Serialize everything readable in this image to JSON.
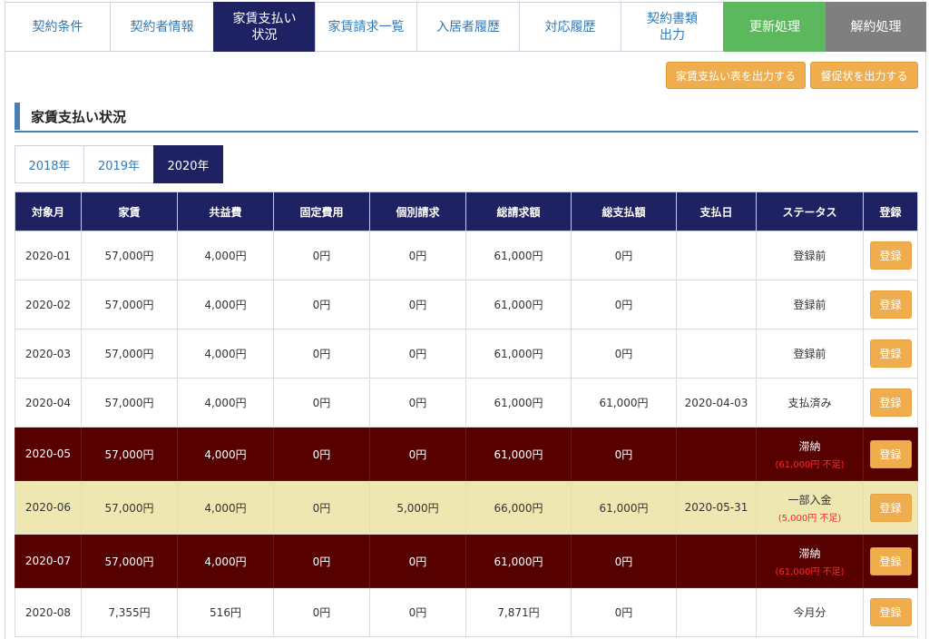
{
  "tabs": [
    {
      "label": "契約条件",
      "state": "normal"
    },
    {
      "label": "契約者情報",
      "state": "normal"
    },
    {
      "label": "家賃支払い\n状況",
      "state": "active"
    },
    {
      "label": "家賃請求一覧",
      "state": "normal"
    },
    {
      "label": "入居者履歴",
      "state": "normal"
    },
    {
      "label": "対応履歴",
      "state": "normal"
    },
    {
      "label": "契約書類\n出力",
      "state": "normal"
    },
    {
      "label": "更新処理",
      "state": "renew"
    },
    {
      "label": "解約処理",
      "state": "cancel"
    }
  ],
  "actions": {
    "export_rent_table": "家賃支払い表を出力する",
    "export_reminder": "督促状を出力する"
  },
  "section_title": "家賃支払い状況",
  "years": [
    {
      "label": "2018年",
      "active": false
    },
    {
      "label": "2019年",
      "active": false
    },
    {
      "label": "2020年",
      "active": true
    }
  ],
  "table": {
    "headers": [
      "対象月",
      "家賃",
      "共益費",
      "固定費用",
      "個別請求",
      "総請求額",
      "総支払額",
      "支払日",
      "ステータス",
      "登録"
    ],
    "register_label": "登録",
    "rows": [
      {
        "month": "2020-01",
        "rent": "57,000円",
        "common": "4,000円",
        "fixed": "0円",
        "individual": "0円",
        "billed": "61,000円",
        "paid": "0円",
        "paydate": "",
        "status": "登録前",
        "shortage": "",
        "type": "normal"
      },
      {
        "month": "2020-02",
        "rent": "57,000円",
        "common": "4,000円",
        "fixed": "0円",
        "individual": "0円",
        "billed": "61,000円",
        "paid": "0円",
        "paydate": "",
        "status": "登録前",
        "shortage": "",
        "type": "normal"
      },
      {
        "month": "2020-03",
        "rent": "57,000円",
        "common": "4,000円",
        "fixed": "0円",
        "individual": "0円",
        "billed": "61,000円",
        "paid": "0円",
        "paydate": "",
        "status": "登録前",
        "shortage": "",
        "type": "normal"
      },
      {
        "month": "2020-04",
        "rent": "57,000円",
        "common": "4,000円",
        "fixed": "0円",
        "individual": "0円",
        "billed": "61,000円",
        "paid": "61,000円",
        "paydate": "2020-04-03",
        "status": "支払済み",
        "shortage": "",
        "type": "normal"
      },
      {
        "month": "2020-05",
        "rent": "57,000円",
        "common": "4,000円",
        "fixed": "0円",
        "individual": "0円",
        "billed": "61,000円",
        "paid": "0円",
        "paydate": "",
        "status": "滞納",
        "shortage": "(61,000円 不足)",
        "type": "late"
      },
      {
        "month": "2020-06",
        "rent": "57,000円",
        "common": "4,000円",
        "fixed": "0円",
        "individual": "5,000円",
        "billed": "66,000円",
        "paid": "61,000円",
        "paydate": "2020-05-31",
        "status": "一部入金",
        "shortage": "(5,000円 不足)",
        "type": "partial"
      },
      {
        "month": "2020-07",
        "rent": "57,000円",
        "common": "4,000円",
        "fixed": "0円",
        "individual": "0円",
        "billed": "61,000円",
        "paid": "0円",
        "paydate": "",
        "status": "滞納",
        "shortage": "(61,000円 不足)",
        "type": "late"
      },
      {
        "month": "2020-08",
        "rent": "7,355円",
        "common": "516円",
        "fixed": "0円",
        "individual": "0円",
        "billed": "7,871円",
        "paid": "0円",
        "paydate": "",
        "status": "今月分",
        "shortage": "",
        "type": "normal"
      }
    ]
  }
}
